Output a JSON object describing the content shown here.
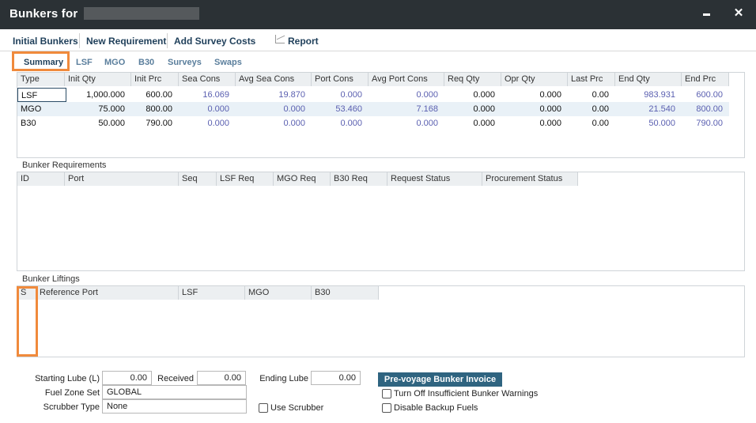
{
  "window": {
    "title": "Bunkers for"
  },
  "toolbar": {
    "initial_bunkers": "Initial Bunkers",
    "new_requirement": "New Requirement",
    "add_survey_costs": "Add Survey Costs",
    "report": "Report"
  },
  "tabs": [
    "Summary",
    "LSF",
    "MGO",
    "B30",
    "Surveys",
    "Swaps"
  ],
  "summary": {
    "columns": [
      "Type",
      "Init Qty",
      "Init Prc",
      "Sea Cons",
      "Avg Sea Cons",
      "Port Cons",
      "Avg Port Cons",
      "Req Qty",
      "Opr Qty",
      "Last Prc",
      "End Qty",
      "End Prc"
    ],
    "rows": [
      [
        "LSF",
        "1,000.000",
        "600.00",
        "16.069",
        "19.870",
        "0.000",
        "0.000",
        "0.000",
        "0.000",
        "0.00",
        "983.931",
        "600.00"
      ],
      [
        "MGO",
        "75.000",
        "800.00",
        "0.000",
        "0.000",
        "53.460",
        "7.168",
        "0.000",
        "0.000",
        "0.00",
        "21.540",
        "800.00"
      ],
      [
        "B30",
        "50.000",
        "790.00",
        "0.000",
        "0.000",
        "0.000",
        "0.000",
        "0.000",
        "0.000",
        "0.00",
        "50.000",
        "790.00"
      ]
    ]
  },
  "requirements": {
    "label": "Bunker Requirements",
    "columns": [
      "ID",
      "Port",
      "Seq",
      "LSF Req",
      "MGO Req",
      "B30 Req",
      "Request Status",
      "Procurement Status"
    ]
  },
  "liftings": {
    "label": "Bunker Liftings",
    "columns": [
      "S",
      "Reference Port",
      "LSF",
      "MGO",
      "B30"
    ]
  },
  "form": {
    "starting_lube_label": "Starting Lube (L)",
    "starting_lube": "0.00",
    "received_label": "Received",
    "received": "0.00",
    "ending_lube_label": "Ending Lube",
    "ending_lube": "0.00",
    "fuel_zone_set_label": "Fuel Zone Set",
    "fuel_zone_set": "GLOBAL",
    "scrubber_type_label": "Scrubber Type",
    "scrubber_type": "None",
    "use_scrubber": "Use Scrubber",
    "pre_voyage_invoice": "Pre-voyage Bunker Invoice",
    "turn_off_warnings": "Turn Off Insufficient Bunker Warnings",
    "disable_backup_fuels": "Disable Backup Fuels"
  },
  "colors": {
    "titlebar": "#2b3135",
    "highlight": "#f08a3c",
    "value_blue": "#5a5fb0",
    "button": "#2f6480"
  }
}
